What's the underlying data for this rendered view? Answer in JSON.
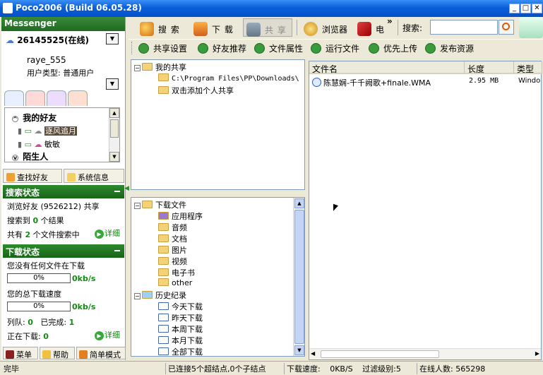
{
  "window": {
    "title": "Poco2006 (Build 06.05.28)"
  },
  "left": {
    "messenger_title": "Messenger",
    "user_id": "26145525",
    "online_status": "在线",
    "nickname": "raye_555",
    "user_type": "用户类型: 普通用户",
    "groups": [
      {
        "label": "我的好友",
        "members": [
          {
            "name": "逐风追月",
            "selected": true
          },
          {
            "name": "敏敏",
            "selected": false
          }
        ]
      },
      {
        "label": "陌生人"
      }
    ],
    "find_friend": "查找好友",
    "system_info": "系统信息",
    "search_status": {
      "title": "搜索状态",
      "browse": "浏览好友 (9526212) 共享",
      "found_prefix": "搜索到",
      "found_count": "0",
      "found_suffix": "个结果",
      "total_prefix": "共有",
      "total_count": "2",
      "total_suffix": "个文件搜索中",
      "detail": "详细"
    },
    "download_status": {
      "title": "下载状态",
      "no_download": "您没有任何文件在下载",
      "total_speed_label": "您的总下载速度",
      "progress1": "0%",
      "progress1_value": 0,
      "speed1": "0kb/s",
      "progress2": "0%",
      "progress2_value": 0,
      "speed2": "0kb/s",
      "queue_label": "列队:",
      "queue_count": "0",
      "done_label": "已完成:",
      "done_count": "1",
      "downloading_label": "正在下载:",
      "downloading_count": "0",
      "detail": "详细"
    },
    "bottom": {
      "menu": "菜单",
      "help": "帮助",
      "simple_mode": "简单模式"
    }
  },
  "toolbar": {
    "search": "搜 索",
    "download": "下 载",
    "share": "共 享",
    "browser": "浏览器",
    "phone": "电",
    "more": "»",
    "search_label": "搜索:",
    "search_value": ""
  },
  "toolbar2": {
    "share_settings": "共享设置",
    "recommend": "好友推荐",
    "file_props": "文件属性",
    "run_file": "运行文件",
    "priority_upload": "优先上传",
    "publish": "发布资源"
  },
  "share_tree": {
    "root": "我的共享",
    "path": "C:\\Program Files\\PP\\Downloads\\",
    "add": "双击添加个人共享"
  },
  "download_tree": {
    "root": "下载文件",
    "items": [
      "应用程序",
      "音频",
      "文档",
      "图片",
      "视频",
      "电子书",
      "other"
    ],
    "history_root": "历史纪录",
    "history": [
      "今天下载",
      "昨天下载",
      "本周下载",
      "本月下载",
      "全部下载"
    ]
  },
  "file_list": {
    "columns": [
      "文件名",
      "长度",
      "类型"
    ],
    "rows": [
      {
        "name": "陈慧娴-千千阙歌+finale.WMA",
        "size": "2.95 MB",
        "type": "Windo"
      }
    ]
  },
  "status": {
    "left": "完毕",
    "connection": "已连接5个超结点,0个子结点",
    "speed": "下载速度: 0KB/S",
    "filter": "过滤级别:5",
    "online": "在线人数: 565298"
  }
}
